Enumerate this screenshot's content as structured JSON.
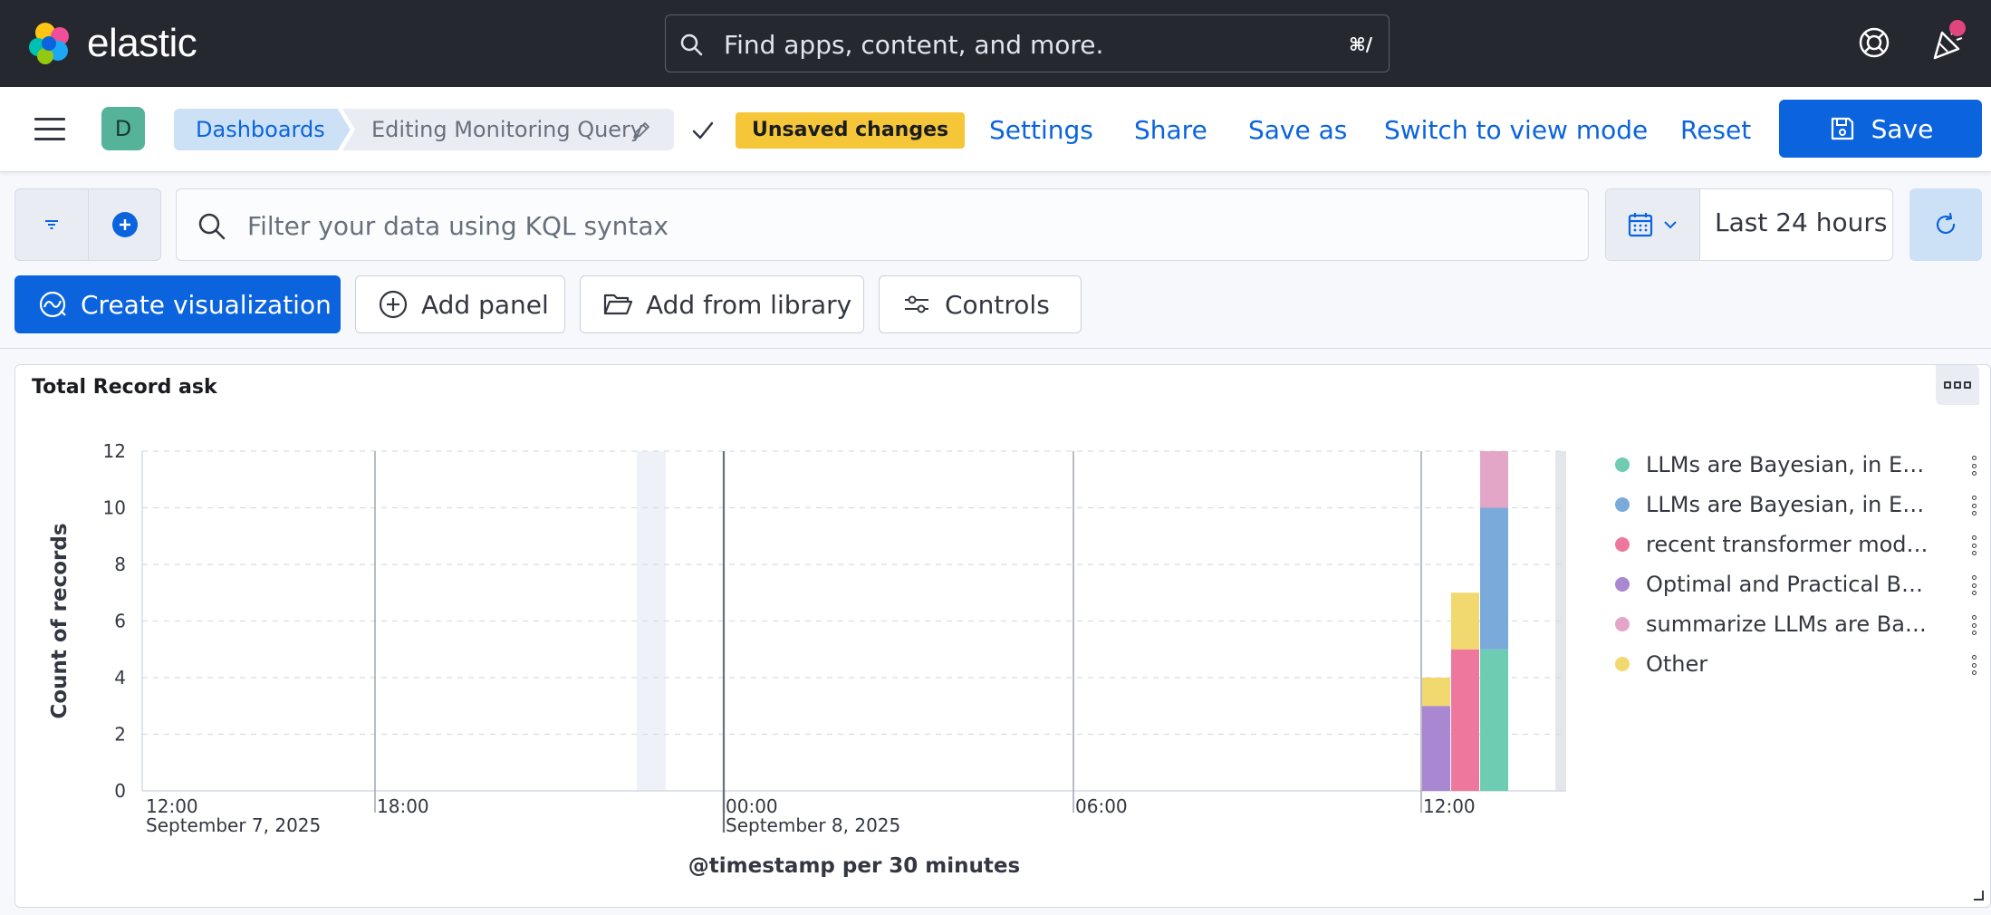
{
  "topbar": {
    "logo_text": "elastic",
    "search_placeholder": "Find apps, content, and more.",
    "search_shortcut": "⌘/"
  },
  "header": {
    "avatar_letter": "D",
    "breadcrumbs": [
      "Dashboards",
      "Editing Monitoring Query"
    ],
    "unsaved_badge": "Unsaved changes",
    "links": [
      "Settings",
      "Share",
      "Save as",
      "Switch to view mode",
      "Reset"
    ],
    "save_label": "Save"
  },
  "querybar": {
    "kql_placeholder": "Filter your data using KQL syntax",
    "date_range": "Last 24 hours"
  },
  "toolbar": {
    "create_visualization": "Create visualization",
    "add_panel": "Add panel",
    "add_from_library": "Add from library",
    "controls": "Controls"
  },
  "panel": {
    "title": "Total Record ask"
  },
  "colors": {
    "accent": "#0b64dd",
    "topbar_bg": "#25282f",
    "badge": "#f5c637"
  },
  "chart_data": {
    "type": "bar",
    "stacked": true,
    "ylabel": "Count of records",
    "xlabel": "@timestamp per 30 minutes",
    "ylim": [
      0,
      12
    ],
    "yticks": [
      0,
      2,
      4,
      6,
      8,
      10,
      12
    ],
    "x_ticks": [
      {
        "label": "12:00",
        "sublabel": "September 7, 2025"
      },
      {
        "label": "18:00",
        "sublabel": ""
      },
      {
        "label": "00:00",
        "sublabel": "September 8, 2025"
      },
      {
        "label": "06:00",
        "sublabel": ""
      },
      {
        "label": "12:00",
        "sublabel": ""
      }
    ],
    "categories": [
      "12:00",
      "12:30",
      "13:00"
    ],
    "series": [
      {
        "name": "LLMs are Bayesian, in Exp...",
        "color": "#6dccb1",
        "values": [
          0,
          0,
          5
        ]
      },
      {
        "name": "LLMs are Bayesian, in Exp...",
        "color": "#79aad9",
        "values": [
          0,
          0,
          5
        ]
      },
      {
        "name": "recent transformer models",
        "color": "#ee789d",
        "values": [
          0,
          5,
          0
        ]
      },
      {
        "name": "Optimal and Practical Bat...",
        "color": "#a987d1",
        "values": [
          3,
          0,
          0
        ]
      },
      {
        "name": "summarize LLMs are Baye...",
        "color": "#e4a6c7",
        "values": [
          0,
          0,
          2
        ]
      },
      {
        "name": "Other",
        "color": "#f1d86f",
        "values": [
          1,
          2,
          0
        ]
      }
    ],
    "legend_position": "right",
    "grid": true
  }
}
